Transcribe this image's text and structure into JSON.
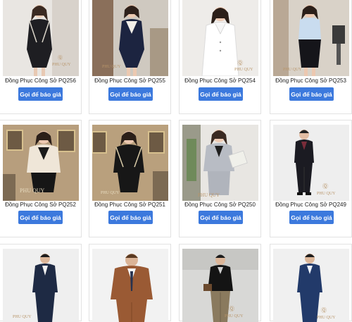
{
  "products": [
    {
      "name": "Đồng Phục Công Sở PQ256",
      "button": "Gọi để báo giá"
    },
    {
      "name": "Đồng Phục Công Sở PQ255",
      "button": "Gọi để báo giá"
    },
    {
      "name": "Đồng Phục Công Sở PQ254",
      "button": "Gọi để báo giá"
    },
    {
      "name": "Đồng Phục Công Sở PQ253",
      "button": "Gọi để báo giá"
    },
    {
      "name": "Đồng Phục Công Sở PQ252",
      "button": "Gọi để báo giá"
    },
    {
      "name": "Đồng Phục Công Sở PQ251",
      "button": "Gọi để báo giá"
    },
    {
      "name": "Đồng Phục Công Sở PQ250",
      "button": "Gọi để báo giá"
    },
    {
      "name": "Đồng Phục Công Sở PQ249",
      "button": "Gọi để báo giá"
    }
  ],
  "watermark": "PHU QUY",
  "colors": {
    "button": "#3c79dd",
    "border": "#e2e2e2"
  }
}
